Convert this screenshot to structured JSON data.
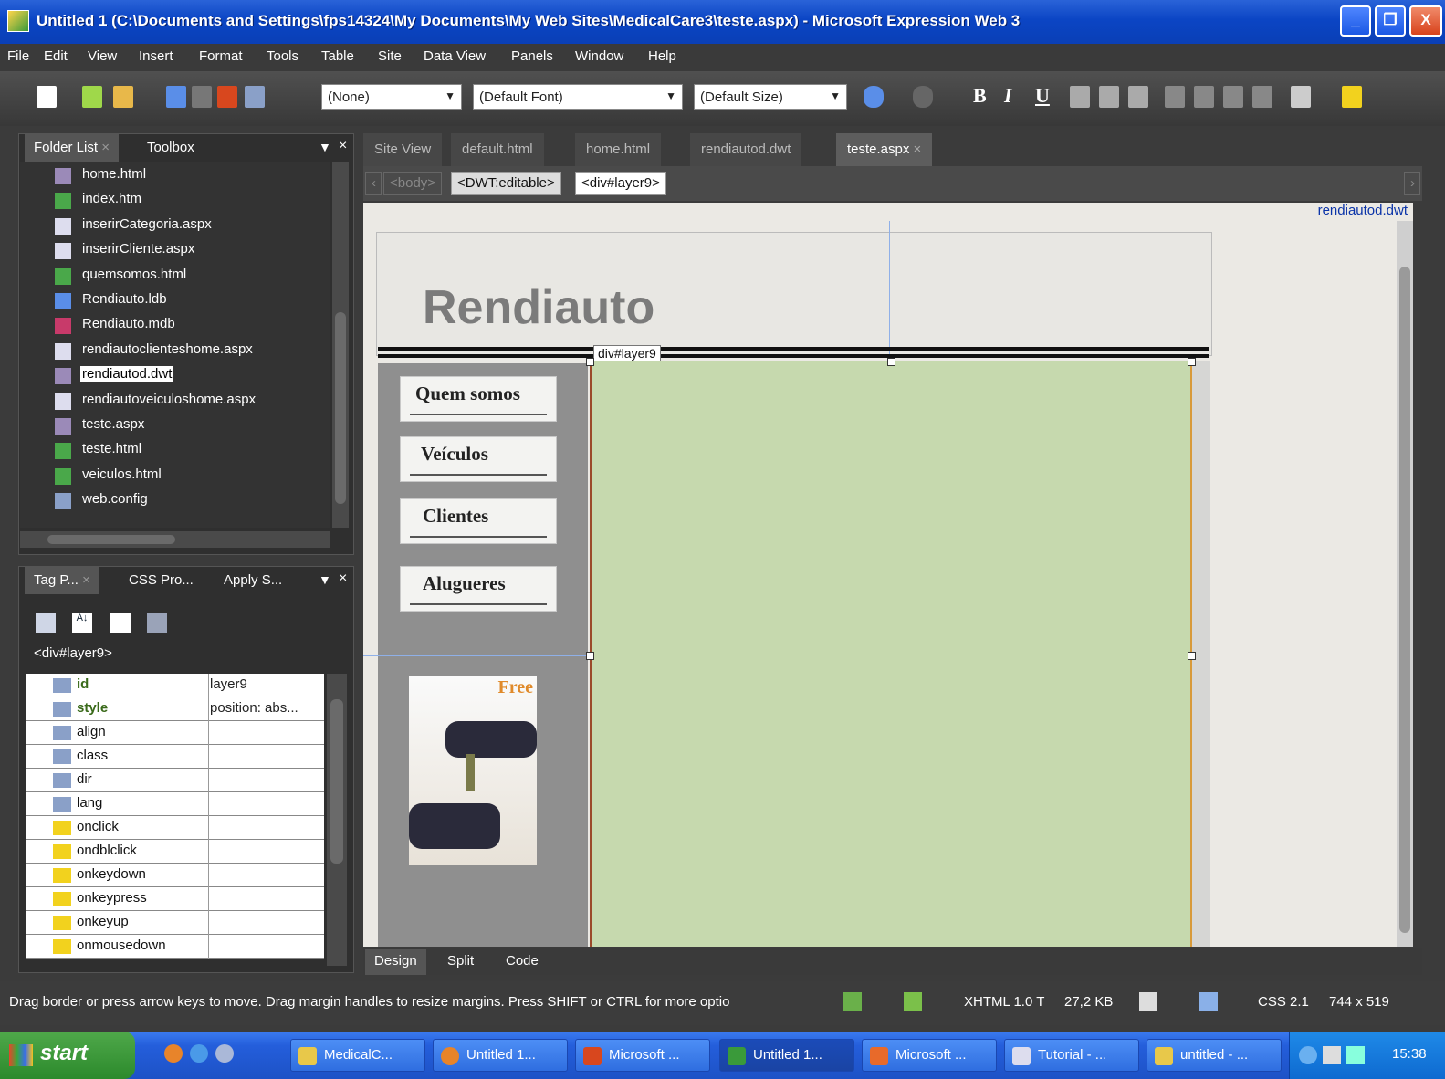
{
  "window": {
    "title": "Untitled 1 (C:\\Documents and Settings\\fps14324\\My Documents\\My Web Sites\\MedicalCare3\\teste.aspx) - Microsoft Expression Web 3",
    "min": "_",
    "max": "❐",
    "close": "X"
  },
  "menu": [
    "File",
    "Edit",
    "View",
    "Insert",
    "Format",
    "Tools",
    "Table",
    "Site",
    "Data View",
    "Panels",
    "Window",
    "Help"
  ],
  "toolbar": {
    "style_value": "(None)",
    "font_value": "(Default Font)",
    "size_value": "(Default Size)",
    "bold": "B",
    "italic": "I",
    "underline": "U"
  },
  "folder_panel": {
    "tabs": [
      "Folder List",
      "Toolbox"
    ],
    "files": [
      {
        "name": "home.html",
        "icon": "dwt-page-icon"
      },
      {
        "name": "index.htm",
        "icon": "html-page-icon"
      },
      {
        "name": "inserirCategoria.aspx",
        "icon": "aspx-page-icon"
      },
      {
        "name": "inserirCliente.aspx",
        "icon": "aspx-page-icon"
      },
      {
        "name": "quemsomos.html",
        "icon": "html-page-icon"
      },
      {
        "name": "Rendiauto.ldb",
        "icon": "ldb-file-icon"
      },
      {
        "name": "Rendiauto.mdb",
        "icon": "access-db-icon"
      },
      {
        "name": "rendiautoclienteshome.aspx",
        "icon": "aspx-page-icon"
      },
      {
        "name": "rendiautod.dwt",
        "icon": "dwt-page-icon",
        "selected": true
      },
      {
        "name": "rendiautoveiculoshome.aspx",
        "icon": "aspx-page-icon"
      },
      {
        "name": "teste.aspx",
        "icon": "dwt-page-icon"
      },
      {
        "name": "teste.html",
        "icon": "html-page-icon"
      },
      {
        "name": "veiculos.html",
        "icon": "html-page-icon"
      },
      {
        "name": "web.config",
        "icon": "config-file-icon"
      }
    ]
  },
  "tag_panel": {
    "tabs": [
      "Tag P...",
      "CSS Pro...",
      "Apply S..."
    ],
    "selected_tag": "<div#layer9>",
    "props": [
      {
        "name": "id",
        "value": "layer9",
        "bold": true,
        "kind": "attr"
      },
      {
        "name": "style",
        "value": "position: abs...",
        "bold": true,
        "kind": "attr"
      },
      {
        "name": "align",
        "value": "",
        "kind": "attr"
      },
      {
        "name": "class",
        "value": "",
        "kind": "attr"
      },
      {
        "name": "dir",
        "value": "",
        "kind": "attr"
      },
      {
        "name": "lang",
        "value": "",
        "kind": "attr"
      },
      {
        "name": "onclick",
        "value": "",
        "kind": "event"
      },
      {
        "name": "ondblclick",
        "value": "",
        "kind": "event"
      },
      {
        "name": "onkeydown",
        "value": "",
        "kind": "event"
      },
      {
        "name": "onkeypress",
        "value": "",
        "kind": "event"
      },
      {
        "name": "onkeyup",
        "value": "",
        "kind": "event"
      },
      {
        "name": "onmousedown",
        "value": "",
        "kind": "event"
      }
    ]
  },
  "doc_tabs": [
    "Site View",
    "default.html",
    "home.html",
    "rendiautod.dwt",
    "teste.aspx"
  ],
  "breadcrumbs": [
    "<body>",
    "<DWT:editable>",
    "<div#layer9>"
  ],
  "design": {
    "template_name": "rendiautod.dwt",
    "site_title": "Rendiauto",
    "layer_label": "div#layer9",
    "nav": [
      "Quem somos",
      "Veículos",
      "Clientes",
      "Alugueres"
    ],
    "promo_text": "Free"
  },
  "view_tabs": [
    "Design",
    "Split",
    "Code"
  ],
  "status": {
    "message": "Drag border or press arrow keys to move. Drag margin handles to resize margins. Press SHIFT or CTRL for more optio",
    "doctype": "XHTML 1.0 T",
    "size": "27,2 KB",
    "css": "CSS 2.1",
    "dims": "744 x 519"
  },
  "taskbar": {
    "start": "start",
    "tasks": [
      "MedicalC...",
      "Untitled 1...",
      "Microsoft ...",
      "Untitled 1...",
      "Microsoft ...",
      "Tutorial - ...",
      "untitled - ..."
    ],
    "clock": "15:38"
  }
}
